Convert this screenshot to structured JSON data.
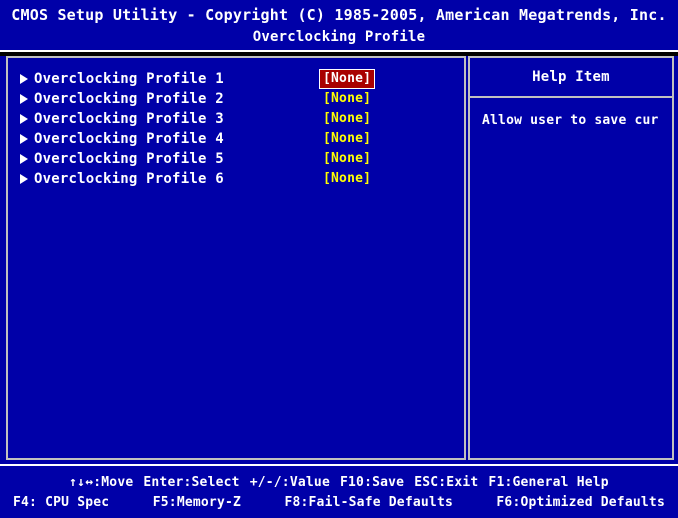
{
  "header": {
    "title": "CMOS Setup Utility - Copyright (C) 1985-2005, American Megatrends, Inc.",
    "subtitle": "Overclocking Profile"
  },
  "menu": {
    "items": [
      {
        "label": "Overclocking Profile 1",
        "value": "[None]",
        "selected": true
      },
      {
        "label": "Overclocking Profile 2",
        "value": "[None]",
        "selected": false
      },
      {
        "label": "Overclocking Profile 3",
        "value": "[None]",
        "selected": false
      },
      {
        "label": "Overclocking Profile 4",
        "value": "[None]",
        "selected": false
      },
      {
        "label": "Overclocking Profile 5",
        "value": "[None]",
        "selected": false
      },
      {
        "label": "Overclocking Profile 6",
        "value": "[None]",
        "selected": false
      }
    ]
  },
  "help": {
    "title": "Help Item",
    "text": "Allow user to save cur"
  },
  "footer": {
    "row1": [
      "↑↓↔:Move",
      "Enter:Select",
      "+/-/:Value",
      "F10:Save",
      "ESC:Exit",
      "F1:General Help"
    ],
    "row2": [
      "F4: CPU Spec",
      "F5:Memory-Z",
      "F8:Fail-Safe Defaults",
      "F6:Optimized Defaults"
    ]
  },
  "colors": {
    "background": "#0000a8",
    "value_text": "#ffff00",
    "selected_bg": "#a80000",
    "text": "#ffffff",
    "border": "#c0c0c0"
  },
  "icons": {
    "menu_item_marker": "triangle-right-icon"
  }
}
